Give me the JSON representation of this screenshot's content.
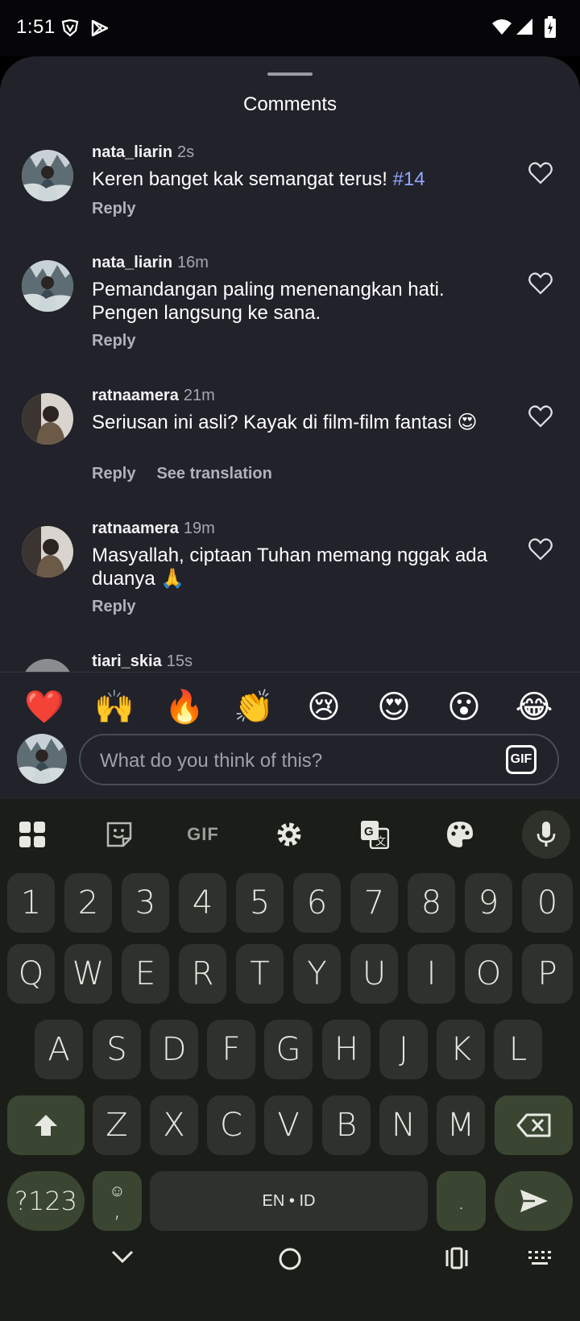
{
  "status_bar": {
    "time": "1:51"
  },
  "sheet": {
    "title": "Comments"
  },
  "comments": [
    {
      "username": "nata_liarin",
      "time": "2s",
      "text": "Keren banget kak semangat terus! ",
      "hashtag": "#14",
      "reply": "Reply",
      "translate": ""
    },
    {
      "username": "nata_liarin",
      "time": "16m",
      "text": "Pemandangan paling menenangkan hati. Pengen langsung ke sana.",
      "hashtag": "",
      "reply": "Reply",
      "translate": ""
    },
    {
      "username": "ratnaamera",
      "time": "21m",
      "text": "Seriusan ini asli? Kayak di film-film fantasi 😍",
      "hashtag": "",
      "reply": "Reply",
      "translate": "See translation"
    },
    {
      "username": "ratnaamera",
      "time": "19m",
      "text": "Masyallah, ciptaan Tuhan memang nggak ada duanya 🙏",
      "hashtag": "",
      "reply": "Reply",
      "translate": ""
    },
    {
      "username": "tiari_skia",
      "time": "15s"
    }
  ],
  "emojis": [
    "❤️",
    "🙌",
    "🔥",
    "👏",
    "😢",
    "😍",
    "😮",
    "😂"
  ],
  "compose": {
    "placeholder": "What do you think of this?",
    "gif_label": "GIF"
  },
  "keyboard": {
    "toolbar": [
      "apps-icon",
      "sticker-icon",
      "gif-icon",
      "settings-icon",
      "translate-icon",
      "palette-icon",
      "mic-icon"
    ],
    "toolbar_gif": "GIF",
    "row_numbers": [
      "1",
      "2",
      "3",
      "4",
      "5",
      "6",
      "7",
      "8",
      "9",
      "0"
    ],
    "row_q": [
      "Q",
      "W",
      "E",
      "R",
      "T",
      "Y",
      "U",
      "I",
      "O",
      "P"
    ],
    "row_a": [
      "A",
      "S",
      "D",
      "F",
      "G",
      "H",
      "J",
      "K",
      "L"
    ],
    "row_z": [
      "Z",
      "X",
      "C",
      "V",
      "B",
      "N",
      "M"
    ],
    "symbols_key": "?123",
    "comma_key": ",",
    "space_label": "EN • ID",
    "period_key": "."
  }
}
